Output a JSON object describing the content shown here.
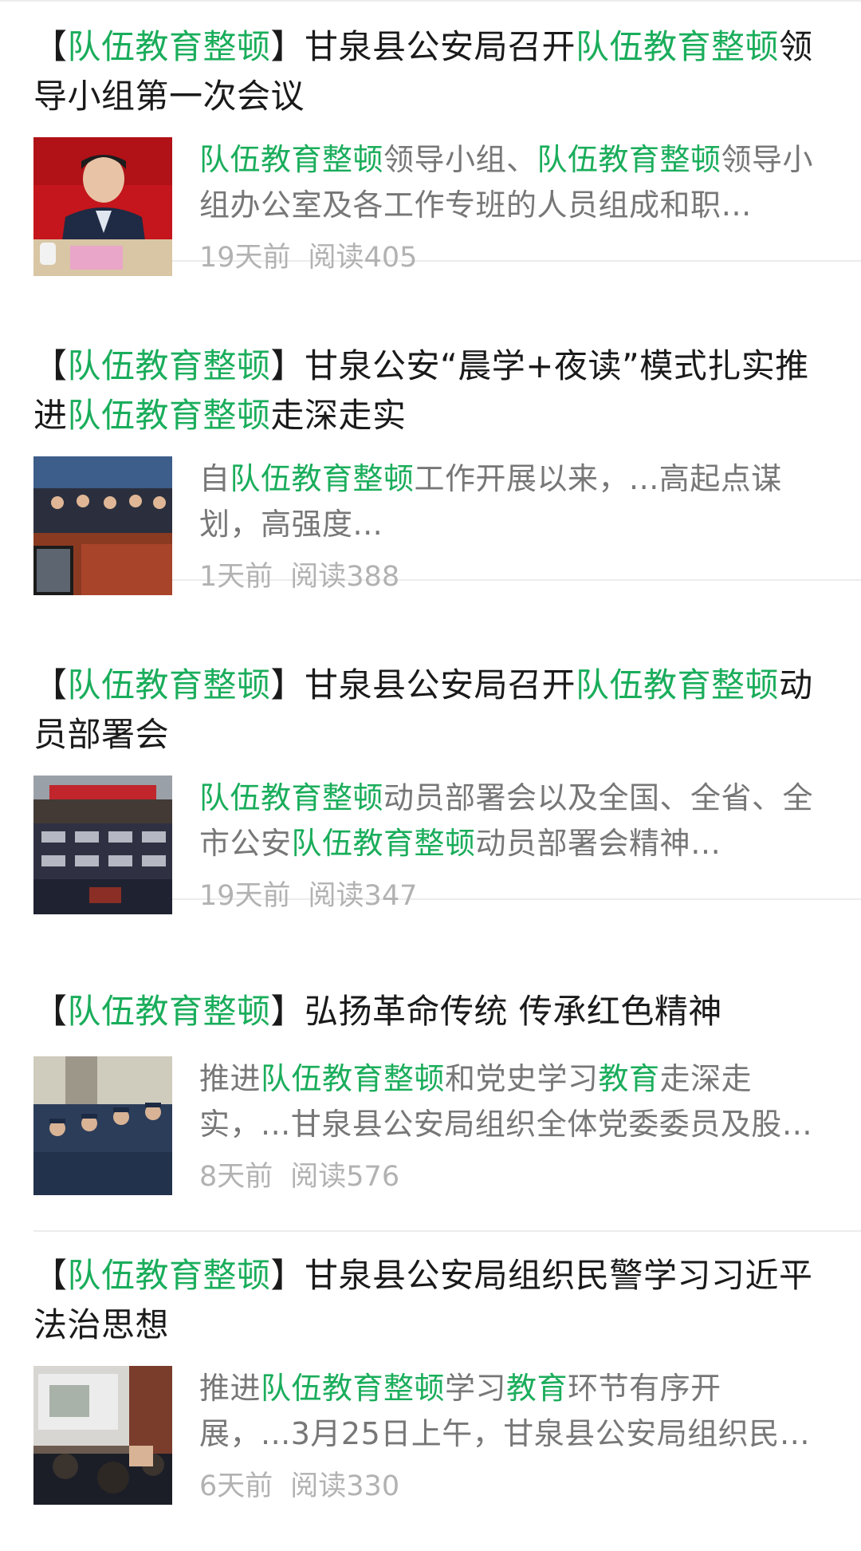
{
  "articles": [
    {
      "title_parts": [
        {
          "text": "【",
          "hl": false
        },
        {
          "text": "队伍教育整顿",
          "hl": true
        },
        {
          "text": "】甘泉县公安局召开",
          "hl": false
        },
        {
          "text": "队伍教育整顿",
          "hl": true
        },
        {
          "text": "领导小组第一次会议",
          "hl": false
        }
      ],
      "summary_parts": [
        {
          "text": "队伍教育整顿",
          "hl": true
        },
        {
          "text": "领导小组、",
          "hl": false
        },
        {
          "text": "队伍教育整顿",
          "hl": true
        },
        {
          "text": "领导小组办公室及各工作专班的人员组成和职…",
          "hl": false
        }
      ],
      "time": "19天前",
      "reads": "阅读405"
    },
    {
      "title_parts": [
        {
          "text": "【",
          "hl": false
        },
        {
          "text": "队伍教育整顿",
          "hl": true
        },
        {
          "text": "】甘泉公安“晨学+夜读”模式扎实推进",
          "hl": false
        },
        {
          "text": "队伍教育整顿",
          "hl": true
        },
        {
          "text": "走深走实",
          "hl": false
        }
      ],
      "summary_parts": [
        {
          "text": "自",
          "hl": false
        },
        {
          "text": "队伍教育整顿",
          "hl": true
        },
        {
          "text": "工作开展以来，...高起点谋划，高强度...",
          "hl": false
        }
      ],
      "time": "1天前",
      "reads": "阅读388"
    },
    {
      "title_parts": [
        {
          "text": "【",
          "hl": false
        },
        {
          "text": "队伍教育整顿",
          "hl": true
        },
        {
          "text": "】甘泉县公安局召开",
          "hl": false
        },
        {
          "text": "队伍教育整顿",
          "hl": true
        },
        {
          "text": "动员部署会",
          "hl": false
        }
      ],
      "summary_parts": [
        {
          "text": "队伍教育整顿",
          "hl": true
        },
        {
          "text": "动员部署会以及全国、全省、全市公安",
          "hl": false
        },
        {
          "text": "队伍教育整顿",
          "hl": true
        },
        {
          "text": "动员部署会精神…",
          "hl": false
        }
      ],
      "time": "19天前",
      "reads": "阅读347"
    },
    {
      "title_parts": [
        {
          "text": "【",
          "hl": false
        },
        {
          "text": "队伍教育整顿",
          "hl": true
        },
        {
          "text": "】弘扬革命传统 传承红色精神",
          "hl": false
        }
      ],
      "summary_parts": [
        {
          "text": "推进",
          "hl": false
        },
        {
          "text": "队伍教育整顿",
          "hl": true
        },
        {
          "text": "和党史学习",
          "hl": false
        },
        {
          "text": "教育",
          "hl": true
        },
        {
          "text": "走深走实，...甘泉县公安局组织全体党委委员及股…",
          "hl": false
        }
      ],
      "time": "8天前",
      "reads": "阅读576"
    },
    {
      "title_parts": [
        {
          "text": "【",
          "hl": false
        },
        {
          "text": "队伍教育整顿",
          "hl": true
        },
        {
          "text": "】甘泉县公安局组织民警学习习近平法治思想",
          "hl": false
        }
      ],
      "summary_parts": [
        {
          "text": "推进",
          "hl": false
        },
        {
          "text": "队伍教育整顿",
          "hl": true
        },
        {
          "text": "学习",
          "hl": false
        },
        {
          "text": "教育",
          "hl": true
        },
        {
          "text": "环节有序开展，...3月25日上午，甘泉县公安局组织民…",
          "hl": false
        }
      ],
      "time": "6天前",
      "reads": "阅读330"
    }
  ],
  "colors": {
    "highlight": "#1aad5b",
    "title": "#1a1a1a",
    "summary": "#777777",
    "meta": "#b2b2b2",
    "divider": "#ececec"
  }
}
